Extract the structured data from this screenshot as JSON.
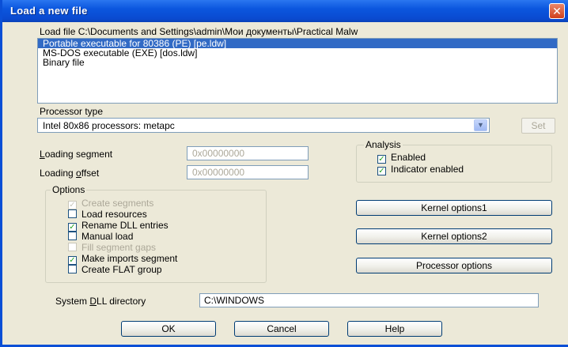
{
  "window": {
    "title": "Load a new file",
    "close_glyph": "✕"
  },
  "load_file": {
    "label": "Load file C:\\Documents and Settings\\admin\\Мои документы\\Practical Malw",
    "items": [
      {
        "label": "Portable executable for 80386 (PE) [pe.ldw]",
        "selected": true
      },
      {
        "label": "MS-DOS executable (EXE) [dos.ldw]",
        "selected": false
      },
      {
        "label": "Binary file",
        "selected": false
      }
    ]
  },
  "processor": {
    "label": "Processor type",
    "value": "Intel 80x86 processors: metapc",
    "set_label": "Set",
    "dropdown_icon": "chevron-down"
  },
  "loading": {
    "segment_label_u": "L",
    "segment_label_rest": "oading segment",
    "segment_value": "0x00000000",
    "offset_label_pre": "Loading ",
    "offset_label_u": "o",
    "offset_label_rest": "ffset",
    "offset_value": "0x00000000"
  },
  "analysis": {
    "legend": "Analysis",
    "enabled_label": "Enabled",
    "enabled_checked": true,
    "indicator_label": "Indicator enabled",
    "indicator_checked": true
  },
  "options": {
    "legend": "Options",
    "items": [
      {
        "label": "Create segments",
        "checked": true,
        "disabled": true
      },
      {
        "label": "Load resources",
        "checked": false,
        "disabled": false
      },
      {
        "label": "Rename DLL entries",
        "checked": true,
        "disabled": false
      },
      {
        "label": "Manual load",
        "checked": false,
        "disabled": false
      },
      {
        "label": "Fill segment gaps",
        "checked": false,
        "disabled": true
      },
      {
        "label": "Make imports segment",
        "checked": true,
        "disabled": false
      },
      {
        "label": "Create FLAT group",
        "checked": false,
        "disabled": false
      }
    ]
  },
  "buttons": {
    "kernel1": "Kernel options1",
    "kernel2": "Kernel options2",
    "processor_options": "Processor options",
    "ok": "OK",
    "cancel": "Cancel",
    "help": "Help"
  },
  "system_dll": {
    "label_pre": "System ",
    "label_u": "D",
    "label_rest": "LL directory",
    "value": "C:\\WINDOWS"
  },
  "colors": {
    "titlebar": "#0a4ad0",
    "selection": "#316ac5",
    "check": "#21a121"
  }
}
